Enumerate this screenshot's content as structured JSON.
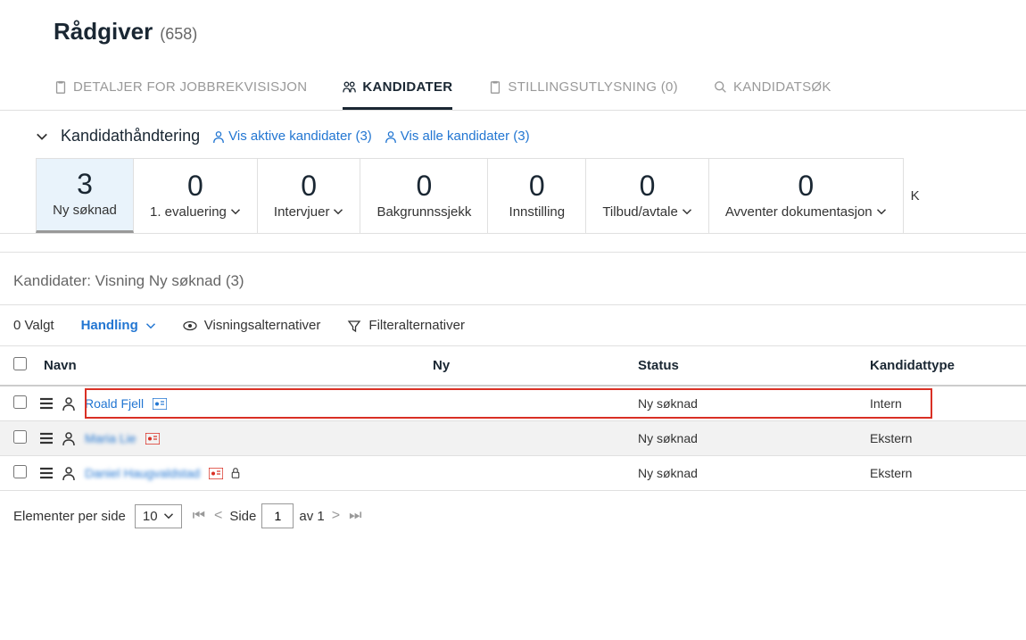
{
  "header": {
    "title": "Rådgiver",
    "count": "(658)"
  },
  "tabs": [
    {
      "label": "DETALJER FOR JOBBREKVISISJON",
      "icon": "clipboard"
    },
    {
      "label": "KANDIDATER",
      "icon": "people",
      "active": true
    },
    {
      "label": "STILLINGSUTLYSNING (0)",
      "icon": "clipboard"
    },
    {
      "label": "KANDIDATSØK",
      "icon": "search"
    }
  ],
  "subheader": {
    "title": "Kandidathåndtering",
    "link1": "Vis aktive kandidater (3)",
    "link2": "Vis alle kandidater (3)"
  },
  "stages": [
    {
      "count": "3",
      "label": "Ny søknad",
      "active": true,
      "chev": false
    },
    {
      "count": "0",
      "label": "1. evaluering",
      "chev": true
    },
    {
      "count": "0",
      "label": "Intervjuer",
      "chev": true
    },
    {
      "count": "0",
      "label": "Bakgrunnssjekk",
      "chev": false
    },
    {
      "count": "0",
      "label": "Innstilling",
      "chev": false
    },
    {
      "count": "0",
      "label": "Tilbud/avtale",
      "chev": true
    },
    {
      "count": "0",
      "label": "Avventer dokumentasjon",
      "chev": true
    }
  ],
  "stage_cut": "K",
  "section_title": "Kandidater: Visning Ny søknad (3)",
  "toolbar": {
    "selected": "0 Valgt",
    "action": "Handling",
    "view_opts": "Visningsalternativer",
    "filter_opts": "Filteralternativer"
  },
  "columns": {
    "name": "Navn",
    "ny": "Ny",
    "status": "Status",
    "type": "Kandidattype"
  },
  "rows": [
    {
      "name": "Roald Fjell",
      "status": "Ny søknad",
      "type": "Intern",
      "badge": "blue",
      "highlight": true
    },
    {
      "name": "Maria Lie",
      "status": "Ny søknad",
      "type": "Ekstern",
      "badge": "red",
      "blurred": true,
      "alt": true
    },
    {
      "name": "Daniel Haugvaldstad",
      "status": "Ny søknad",
      "type": "Ekstern",
      "badge": "red",
      "blurred": true,
      "lock": true
    }
  ],
  "pager": {
    "per_page_label": "Elementer per side",
    "per_page_value": "10",
    "side_label": "Side",
    "page_value": "1",
    "av_label": "av 1"
  }
}
